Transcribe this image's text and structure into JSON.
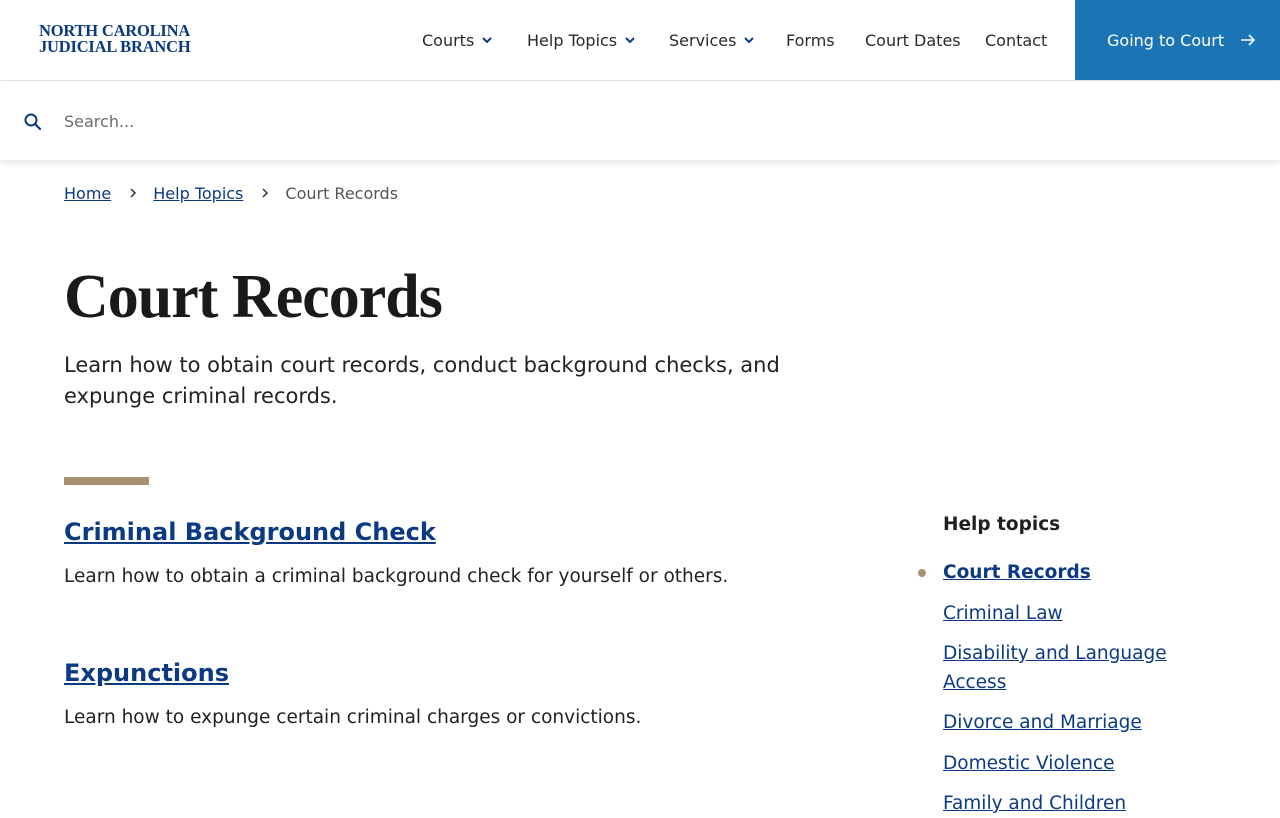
{
  "brand": {
    "line1": "NORTH CAROLINA",
    "line2": "JUDICIAL BRANCH",
    "color": "#0b3a82"
  },
  "nav": {
    "items": [
      {
        "label": "Courts",
        "dropdown": true
      },
      {
        "label": "Help Topics",
        "dropdown": true
      },
      {
        "label": "Services",
        "dropdown": true
      },
      {
        "label": "Forms",
        "dropdown": false
      },
      {
        "label": "Court Dates",
        "dropdown": false
      },
      {
        "label": "Contact",
        "dropdown": false
      }
    ],
    "cta_label": "Going to Court",
    "cta_color": "#1b75b4"
  },
  "search": {
    "placeholder": "Search...",
    "icon": "search-icon"
  },
  "breadcrumb": {
    "home": "Home",
    "help_topics": "Help Topics",
    "current": "Court Records"
  },
  "page": {
    "title": "Court Records",
    "intro": "Learn how to obtain court records, conduct background checks, and expunge criminal records.",
    "accent_color": "#a89070"
  },
  "topics": [
    {
      "title": "Criminal Background Check",
      "description": "Learn how to obtain a criminal background check for yourself or others."
    },
    {
      "title": "Expunctions",
      "description": "Learn how to expunge certain criminal charges or convictions."
    }
  ],
  "sidebar": {
    "title": "Help topics",
    "items": [
      {
        "label": "Court Records",
        "active": true
      },
      {
        "label": "Criminal Law",
        "active": false
      },
      {
        "label": "Disability and Language Access",
        "active": false
      },
      {
        "label": "Divorce and Marriage",
        "active": false
      },
      {
        "label": "Domestic Violence",
        "active": false
      },
      {
        "label": "Family and Children",
        "active": false
      }
    ]
  }
}
